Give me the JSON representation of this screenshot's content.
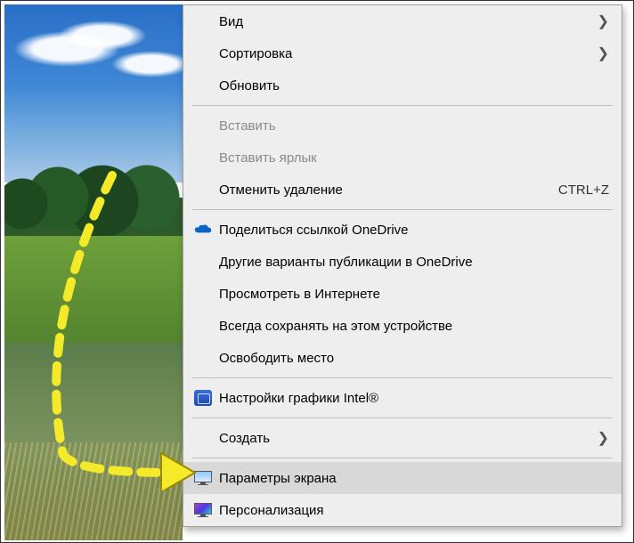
{
  "menu": {
    "items": [
      {
        "label": "Вид",
        "submenu": true
      },
      {
        "label": "Сортировка",
        "submenu": true
      },
      {
        "label": "Обновить"
      }
    ],
    "paste": [
      {
        "label": "Вставить",
        "disabled": true
      },
      {
        "label": "Вставить ярлык",
        "disabled": true
      },
      {
        "label": "Отменить удаление",
        "shortcut": "CTRL+Z"
      }
    ],
    "onedrive": [
      {
        "label": "Поделиться ссылкой OneDrive",
        "icon": "onedrive"
      },
      {
        "label": "Другие варианты публикации в OneDrive"
      },
      {
        "label": "Просмотреть в Интернете"
      },
      {
        "label": "Всегда сохранять на этом устройстве"
      },
      {
        "label": "Освободить место"
      }
    ],
    "intel_label": "Настройки графики Intel®",
    "create_label": "Создать",
    "display_settings_label": "Параметры экрана",
    "personalize_label": "Персонализация"
  }
}
